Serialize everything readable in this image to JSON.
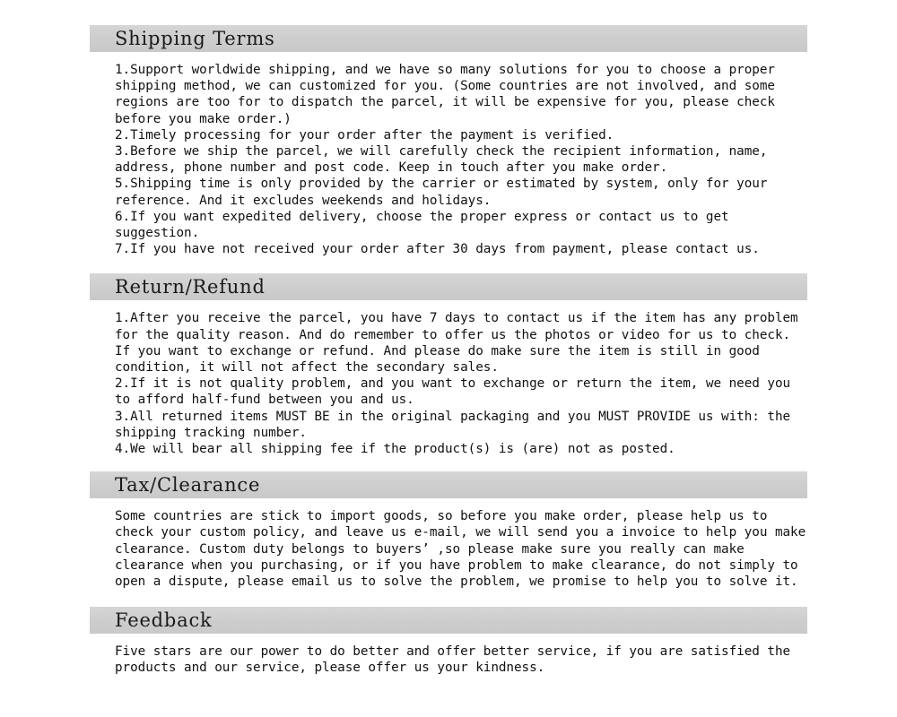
{
  "document": {
    "sections": [
      {
        "id": "shipping-terms",
        "heading": "Shipping Terms",
        "body": "1.Support worldwide shipping, and we have so many solutions for you to choose a proper shipping method, we can customized for you. (Some countries are not involved, and some regions are too for to dispatch the parcel, it will be expensive for you, please check before you make order.)\n2.Timely processing for your order after the payment is verified.\n3.Before we ship the parcel, we will carefully check the recipient information, name, address, phone number and post code. Keep in touch after you make order.\n5.Shipping time is only provided by the carrier or estimated by system, only for your reference. And it excludes weekends and holidays.\n6.If you want expedited delivery, choose the proper express or contact us to get suggestion.\n7.If you have not received your order after 30 days from payment, please contact us."
      },
      {
        "id": "return-refund",
        "heading": "Return/Refund",
        "body": "1.After you receive the parcel, you have 7 days to contact us if the item has any problem for the quality reason. And do remember to offer us the photos or video for us to check. If you want to exchange or refund. And please do make sure the item is still in good condition, it will not affect the secondary sales.\n2.If it is not quality problem, and you want to exchange or return the item, we need you to afford half-fund between you and us.\n3.All returned items MUST BE in the original packaging and you MUST PROVIDE us with: the shipping tracking number.\n4.We will bear all shipping fee if the product(s) is (are) not as posted."
      },
      {
        "id": "tax-clearance",
        "heading": "Tax/Clearance",
        "body": "Some countries are stick to import goods, so before you make order, please help us to check your custom policy, and leave us e-mail, we will send you a invoice to help you make clearance. Custom duty belongs to buyers’ ,so please make sure you really can make clearance when you purchasing, or if you have problem to make clearance, do not simply to open a dispute, please email us to solve the problem, we promise to help you to solve it."
      },
      {
        "id": "feedback",
        "heading": "Feedback",
        "body": "Five stars are our power to do better and offer better service, if you are satisfied the products and our service, please offer us your kindness."
      }
    ]
  },
  "theme": {
    "header_bar_color": "#cdcdcd",
    "text_color": "#111111",
    "background_color": "#ffffff"
  }
}
